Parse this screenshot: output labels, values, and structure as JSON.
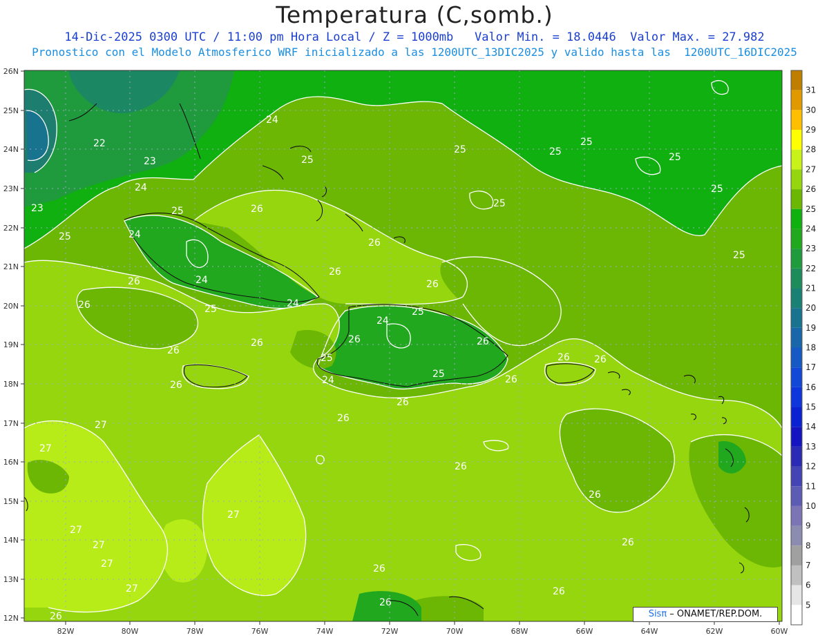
{
  "map": {
    "title": "Temperatura (C,somb.)",
    "subtitle_line1": "14-Dic-2025 0300 UTC / 11:00 pm Hora Local / Z = 1000mb   Valor Min. = 18.0446  Valor Max. = 27.982",
    "subtitle_line2": "Pronostico con el Modelo Atmosferico WRF inicializado a las 1200UTC_13DIC2025 y valido hasta las  1200UTC_16DIC2025",
    "credit_brand": "Sisπ",
    "credit_text": " – ONAMET/REP.DOM.",
    "lon_labels": [
      "82W",
      "80W",
      "78W",
      "76W",
      "74W",
      "72W",
      "70W",
      "68W",
      "66W",
      "64W",
      "62W",
      "60W"
    ],
    "lat_labels": [
      "26N",
      "25N",
      "24N",
      "23N",
      "22N",
      "21N",
      "20N",
      "19N",
      "18N",
      "17N",
      "16N",
      "15N",
      "14N",
      "13N",
      "12N"
    ],
    "contour_labels": [
      "22",
      "23",
      "24",
      "25",
      "26",
      "27"
    ]
  },
  "colorbar": {
    "levels": [
      {
        "label": "31",
        "color": "#c07e00"
      },
      {
        "label": "30",
        "color": "#e09a00"
      },
      {
        "label": "29",
        "color": "#ffbf00"
      },
      {
        "label": "28",
        "color": "#ffff00"
      },
      {
        "label": "27",
        "color": "#c9f21b"
      },
      {
        "label": "26",
        "color": "#96d60f"
      },
      {
        "label": "25",
        "color": "#6cb704"
      },
      {
        "label": "24",
        "color": "#10b010"
      },
      {
        "label": "23",
        "color": "#22a81f"
      },
      {
        "label": "22",
        "color": "#1f9a3c"
      },
      {
        "label": "21",
        "color": "#1d8c5a"
      },
      {
        "label": "20",
        "color": "#1a8074"
      },
      {
        "label": "19",
        "color": "#18738e"
      },
      {
        "label": "18",
        "color": "#1a66aa"
      },
      {
        "label": "17",
        "color": "#1659c4"
      },
      {
        "label": "16",
        "color": "#1248d6"
      },
      {
        "label": "15",
        "color": "#0e36da"
      },
      {
        "label": "14",
        "color": "#0a22d2"
      },
      {
        "label": "13",
        "color": "#1414c0"
      },
      {
        "label": "12",
        "color": "#2a2ab4"
      },
      {
        "label": "11",
        "color": "#4444b4"
      },
      {
        "label": "10",
        "color": "#5c5cb4"
      },
      {
        "label": "9",
        "color": "#7c74b4"
      },
      {
        "label": "8",
        "color": "#8c8cb0"
      },
      {
        "label": "7",
        "color": "#a0a0a0"
      },
      {
        "label": "6",
        "color": "#c0c0c0"
      },
      {
        "label": "5",
        "color": "#e6e6e6"
      },
      {
        "label": "",
        "color": "#ffffff"
      }
    ]
  }
}
